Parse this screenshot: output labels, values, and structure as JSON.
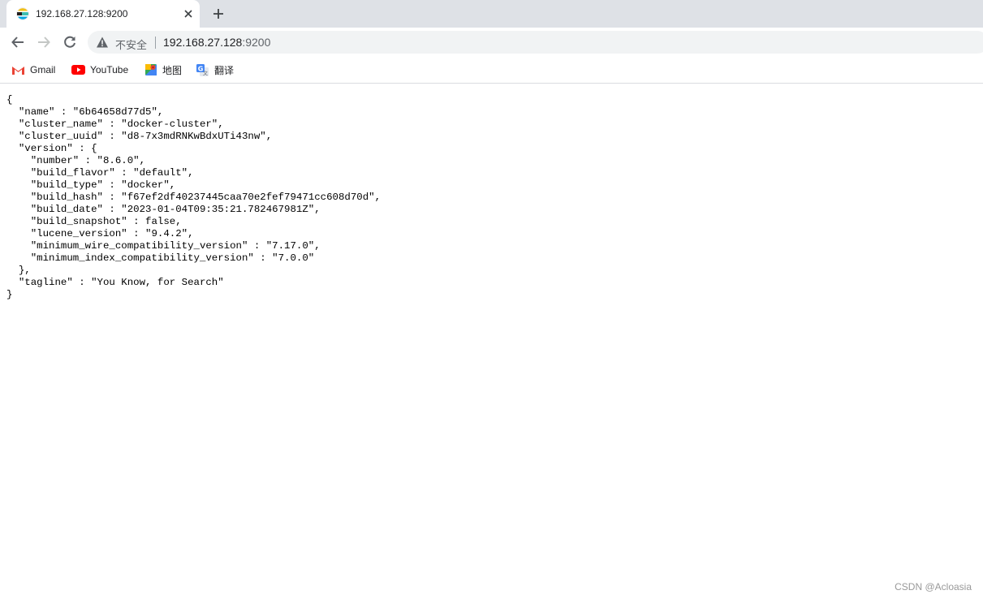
{
  "tab": {
    "title": "192.168.27.128:9200"
  },
  "omnibox": {
    "insecure_label": "不安全",
    "url_host": "192.168.27.128",
    "url_port": ":9200"
  },
  "bookmarks": [
    {
      "label": "Gmail",
      "icon": "gmail-icon"
    },
    {
      "label": "YouTube",
      "icon": "youtube-icon"
    },
    {
      "label": "地图",
      "icon": "maps-icon"
    },
    {
      "label": "翻译",
      "icon": "translate-icon"
    }
  ],
  "response_lines": [
    "{",
    "  \"name\" : \"6b64658d77d5\",",
    "  \"cluster_name\" : \"docker-cluster\",",
    "  \"cluster_uuid\" : \"d8-7x3mdRNKwBdxUTi43nw\",",
    "  \"version\" : {",
    "    \"number\" : \"8.6.0\",",
    "    \"build_flavor\" : \"default\",",
    "    \"build_type\" : \"docker\",",
    "    \"build_hash\" : \"f67ef2df40237445caa70e2fef79471cc608d70d\",",
    "    \"build_date\" : \"2023-01-04T09:35:21.782467981Z\",",
    "    \"build_snapshot\" : false,",
    "    \"lucene_version\" : \"9.4.2\",",
    "    \"minimum_wire_compatibility_version\" : \"7.17.0\",",
    "    \"minimum_index_compatibility_version\" : \"7.0.0\"",
    "  },",
    "  \"tagline\" : \"You Know, for Search\"",
    "}"
  ],
  "watermark": "CSDN @Acloasia",
  "colors": {
    "tabstrip": "#dee1e6",
    "omnibox": "#f1f3f4",
    "youtube": "#ff0000"
  }
}
